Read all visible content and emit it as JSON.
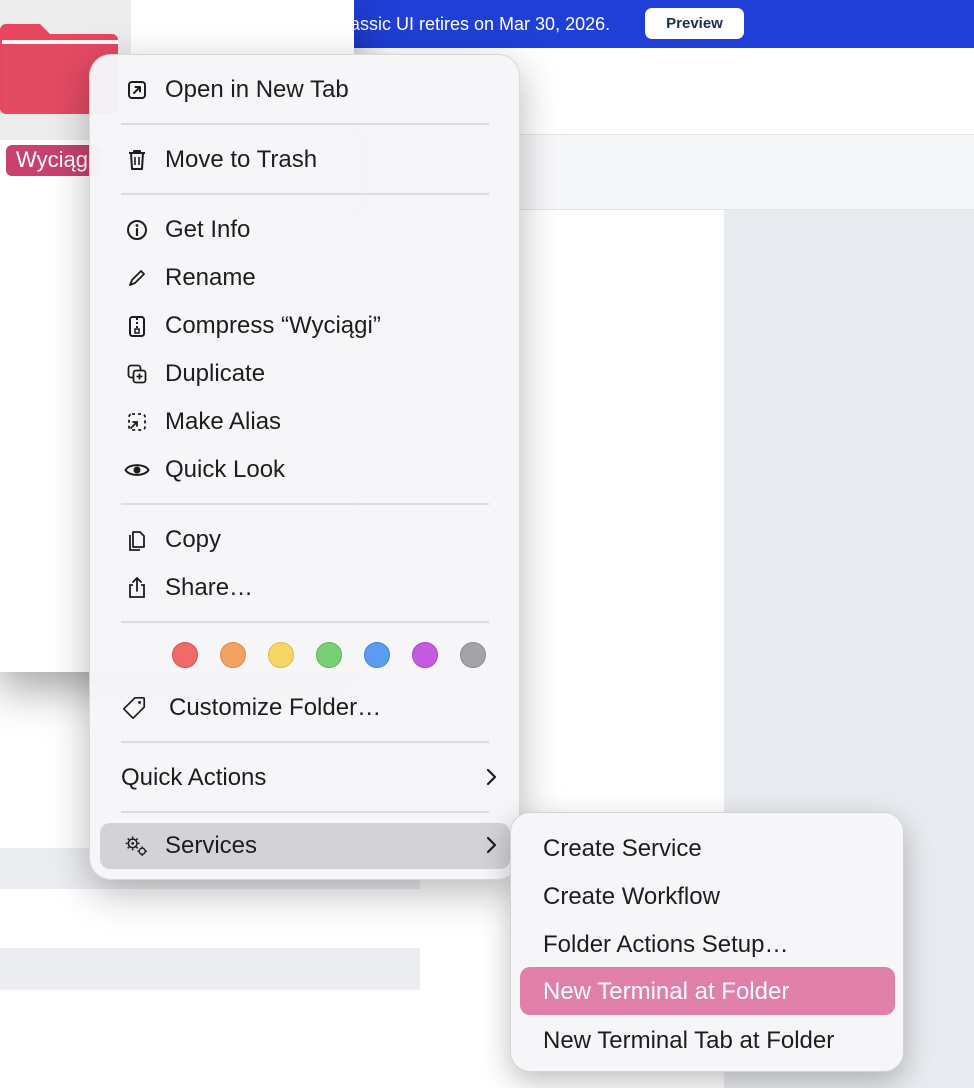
{
  "banner": {
    "text": "assic UI retires on Mar 30, 2026.",
    "preview_label": "Preview",
    "color": "#1f3fd6"
  },
  "folder": {
    "label": "Wyciąg",
    "color": "#e8455f"
  },
  "menu": {
    "open_new_tab": "Open in New Tab",
    "move_to_trash": "Move to Trash",
    "get_info": "Get Info",
    "rename": "Rename",
    "compress": "Compress “Wyciągi”",
    "duplicate": "Duplicate",
    "make_alias": "Make Alias",
    "quick_look": "Quick Look",
    "copy": "Copy",
    "share": "Share…",
    "tags": [
      {
        "name": "red",
        "color": "#f06a6a"
      },
      {
        "name": "orange",
        "color": "#f4a261"
      },
      {
        "name": "yellow",
        "color": "#f8d664"
      },
      {
        "name": "green",
        "color": "#7acf72"
      },
      {
        "name": "blue",
        "color": "#5b9cf2"
      },
      {
        "name": "purple",
        "color": "#c35ce0"
      },
      {
        "name": "gray",
        "color": "#a4a4a8"
      }
    ],
    "customize_folder": "Customize Folder…",
    "quick_actions": "Quick Actions",
    "services": "Services"
  },
  "submenu": {
    "items": [
      "Create Service",
      "Create Workflow",
      "Folder Actions Setup…",
      "New Terminal at Folder",
      "New Terminal Tab at Folder"
    ],
    "selected_index": 3,
    "selected_color": "#e07fa8"
  }
}
